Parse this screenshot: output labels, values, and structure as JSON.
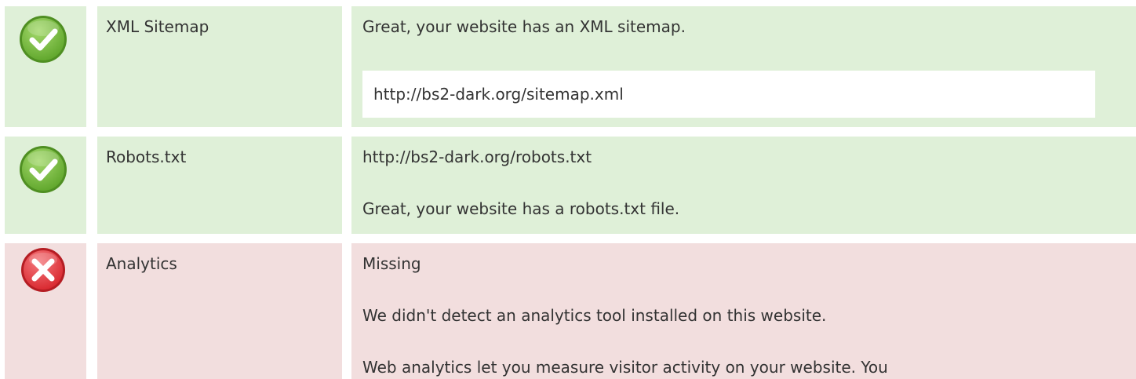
{
  "rows": [
    {
      "status": "pass",
      "icon": "check-circle-icon",
      "name": "XML Sitemap",
      "message": "Great, your website has an XML sitemap.",
      "url": "http://bs2-dark.org/sitemap.xml"
    },
    {
      "status": "pass",
      "icon": "check-circle-icon",
      "name": "Robots.txt",
      "url": "http://bs2-dark.org/robots.txt",
      "message": "Great, your website has a robots.txt file."
    },
    {
      "status": "fail",
      "icon": "cross-circle-icon",
      "name": "Analytics",
      "status_text": "Missing",
      "message": "We didn't detect an analytics tool installed on this website.",
      "detail": "Web analytics let you measure visitor activity on your website. You"
    }
  ],
  "colors": {
    "pass_bg": "#dff0d8",
    "fail_bg": "#f2dede",
    "pass_icon": "#7cc242",
    "fail_icon": "#e5383f",
    "text": "#333333"
  }
}
